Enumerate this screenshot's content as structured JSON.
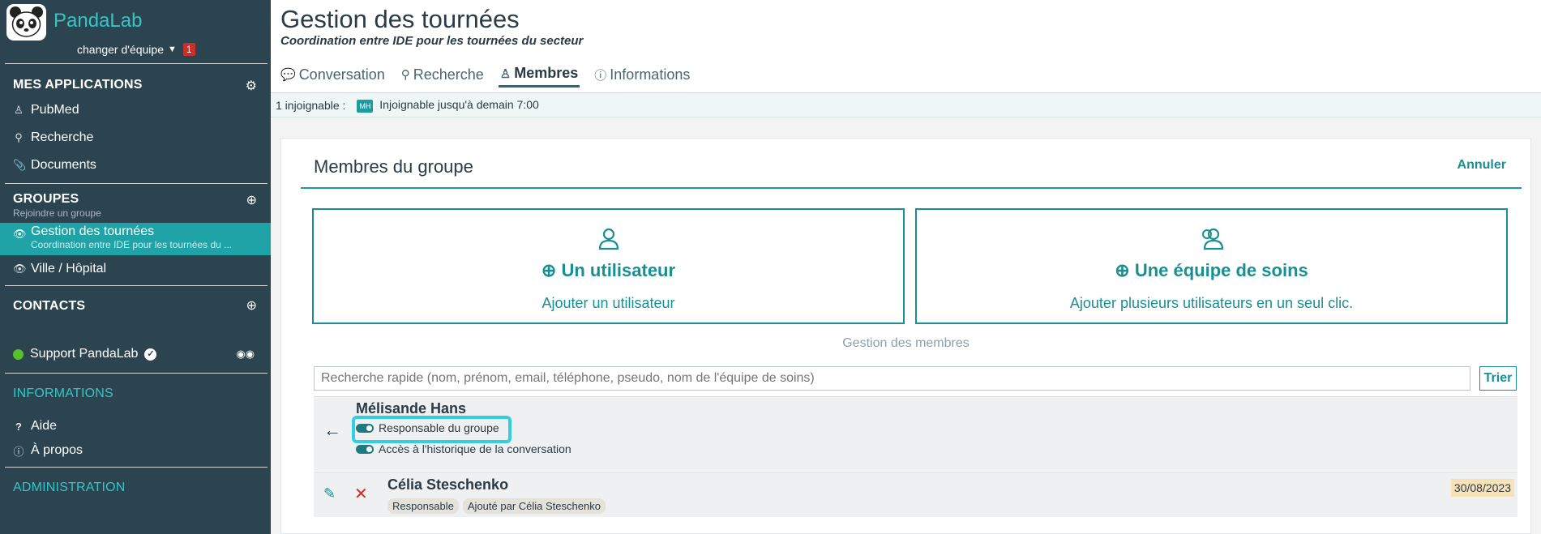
{
  "sidebar": {
    "brand": "PandaLab",
    "team_switch": "changer d'équipe",
    "team_badge": "1",
    "apps": {
      "title": "MES APPLICATIONS",
      "items": [
        {
          "label": "PubMed",
          "icon": "user-md-icon"
        },
        {
          "label": "Recherche",
          "icon": "search-icon"
        },
        {
          "label": "Documents",
          "icon": "paperclip-icon"
        }
      ]
    },
    "groups": {
      "title": "GROUPES",
      "subtitle": "Rejoindre un groupe",
      "items": [
        {
          "label": "Gestion des tournées",
          "sub": "Coordination entre IDE pour les tournées du ..."
        },
        {
          "label": "Ville / Hôpital",
          "sub": ""
        }
      ]
    },
    "contacts": {
      "title": "CONTACTS",
      "items": [
        {
          "label": "Support PandaLab",
          "status_color": "#56c22b"
        }
      ]
    },
    "informations": {
      "title": "INFORMATIONS",
      "items": [
        {
          "label": "Aide",
          "icon": "question-icon"
        },
        {
          "label": "À propos",
          "icon": "info-icon"
        }
      ]
    },
    "administration": {
      "title": "ADMINISTRATION"
    }
  },
  "header": {
    "title": "Gestion des tournées",
    "subtitle": "Coordination entre IDE pour les tournées du secteur",
    "tabs": [
      {
        "label": "Conversation",
        "icon": "chat-icon",
        "active": false
      },
      {
        "label": "Recherche",
        "icon": "search-icon",
        "active": false
      },
      {
        "label": "Membres",
        "icon": "members-icon",
        "active": true
      },
      {
        "label": "Informations",
        "icon": "info-icon",
        "active": false
      }
    ]
  },
  "reach": {
    "count_label": "1 injoignable :",
    "initials": "MH",
    "status": "Injoignable jusqu'à demain 7:00"
  },
  "members": {
    "title": "Membres du groupe",
    "cancel": "Annuler",
    "add_user": {
      "title": "Un utilisateur",
      "desc": "Ajouter un utilisateur"
    },
    "add_team": {
      "title": "Une équipe de soins",
      "desc": "Ajouter plusieurs utilisateurs en un seul clic."
    },
    "manage_label": "Gestion des membres",
    "search_placeholder": "Recherche rapide (nom, prénom, email, téléphone, pseudo, nom de l'équipe de soins)",
    "sort_button": "Trier",
    "editing_row": {
      "name": "Mélisande Hans",
      "toggles": [
        {
          "label": "Responsable du groupe",
          "on": true
        },
        {
          "label": "Accès à l'historique de la conversation",
          "on": true
        }
      ]
    },
    "rows": [
      {
        "name": "Célia Steschenko",
        "chips": [
          "Responsable",
          "Ajouté par Célia Steschenko"
        ],
        "date": "30/08/2023"
      }
    ]
  },
  "colors": {
    "accent": "#1a9ca0",
    "sidebar": "#2c4350",
    "danger": "#c9302c"
  }
}
